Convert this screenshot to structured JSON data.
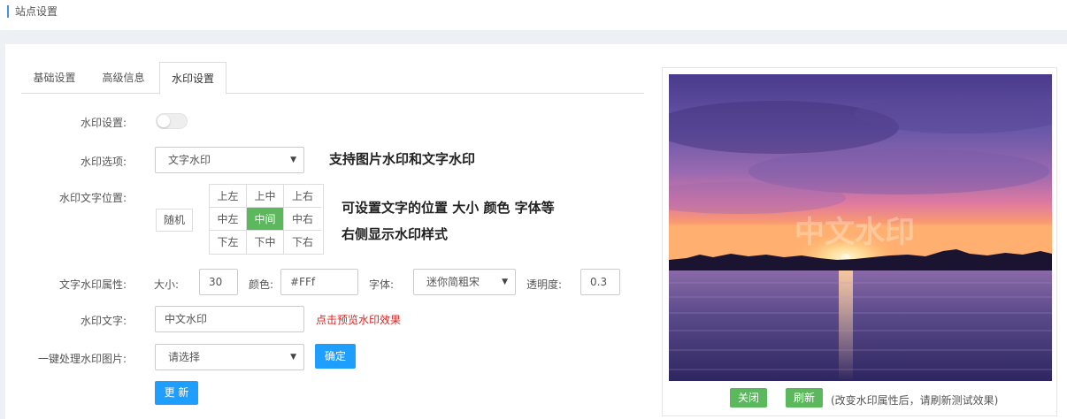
{
  "breadcrumb": "站点设置",
  "tabs": [
    {
      "label": "基础设置",
      "active": false
    },
    {
      "label": "高级信息",
      "active": false
    },
    {
      "label": "水印设置",
      "active": true
    }
  ],
  "form": {
    "watermark_setting_label": "水印设置:",
    "watermark_enabled": false,
    "option_label": "水印选项:",
    "option_value": "文字水印",
    "position_label": "水印文字位置:",
    "random_label": "随机",
    "positions": [
      "上左",
      "上中",
      "上右",
      "中左",
      "中间",
      "中右",
      "下左",
      "下中",
      "下右"
    ],
    "active_position": "中间",
    "attr_label": "文字水印属性:",
    "size_label": "大小:",
    "size_value": "30",
    "color_label": "颜色:",
    "color_value": "#FFf",
    "font_label": "字体:",
    "font_value": "迷你简粗宋",
    "opacity_label": "透明度:",
    "opacity_value": "0.3",
    "text_label": "水印文字:",
    "text_value": "中文水印",
    "preview_link": "点击预览水印效果",
    "batch_label": "一键处理水印图片:",
    "batch_placeholder": "请选择",
    "confirm_label": "确定",
    "update_label": "更 新"
  },
  "notes": {
    "note1": "支持图片水印和文字水印",
    "note2": "可设置文字的位置  大小  颜色  字体等",
    "note3": "右侧显示水印样式"
  },
  "preview": {
    "watermark_text": "中文水印",
    "close_label": "关闭",
    "refresh_label": "刷新",
    "hint": "(改变水印属性后，请刷新测试效果)"
  },
  "colors": {
    "accent_blue": "#1e9fff",
    "green": "#5cb85c",
    "red_link": "#e02020",
    "breadcrumb_bar": "#4a90e2"
  }
}
